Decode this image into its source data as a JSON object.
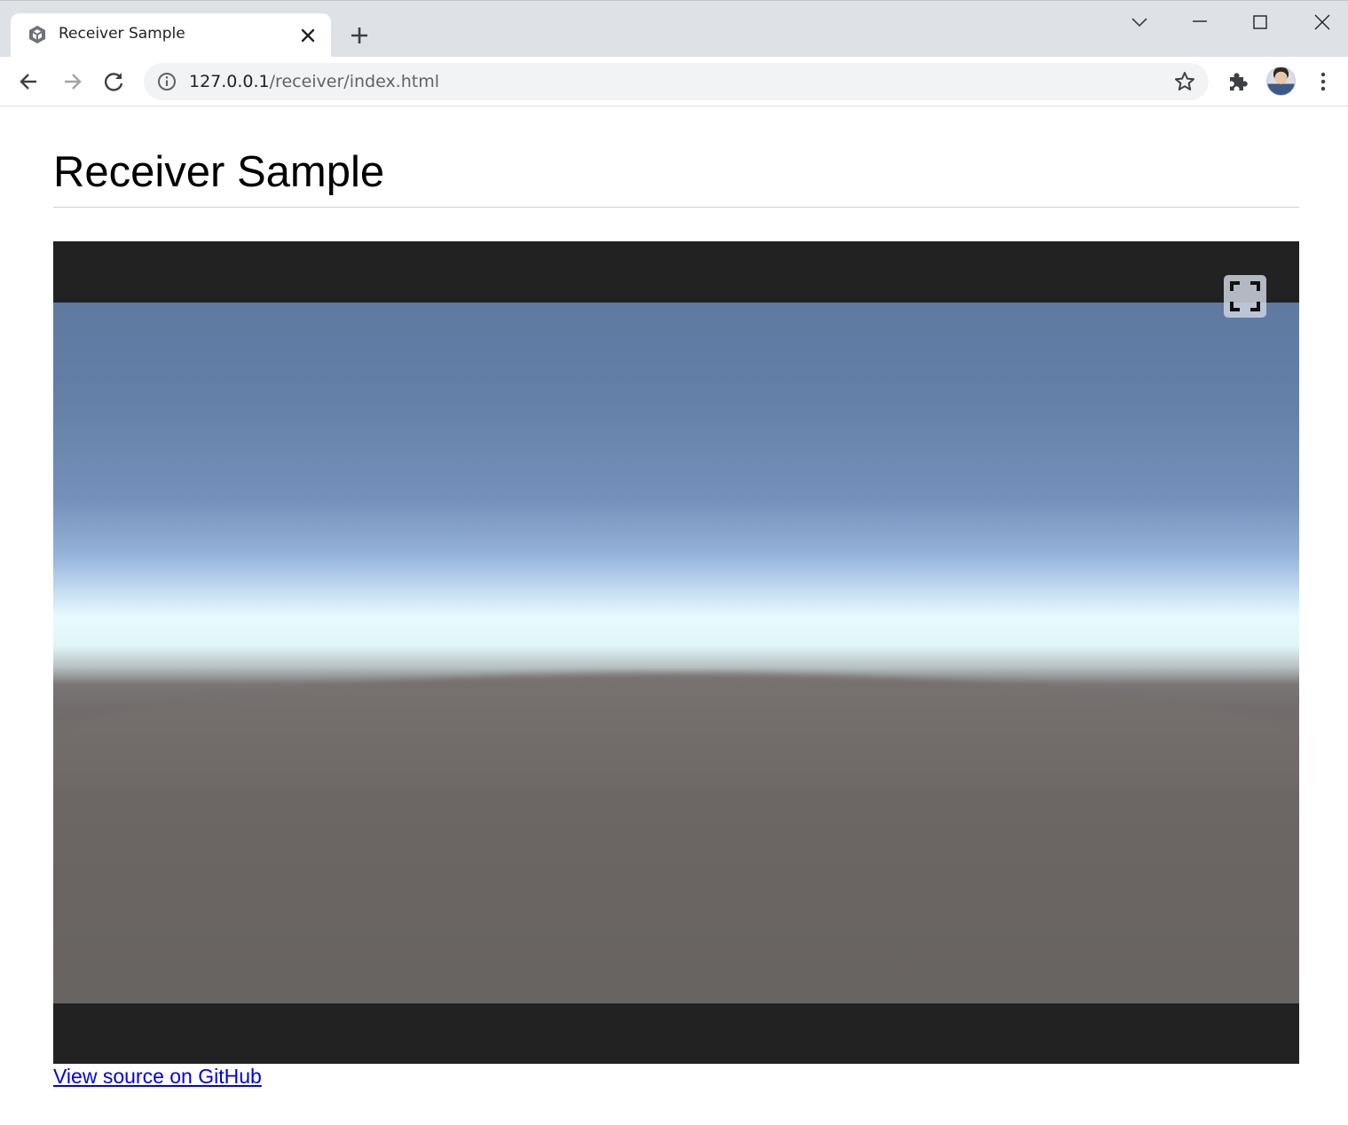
{
  "browser": {
    "tab": {
      "title": "Receiver Sample",
      "favicon": "unity-logo-icon"
    },
    "address_bar": {
      "host": "127.0.0.1",
      "path": "/receiver/index.html"
    },
    "icons": {
      "back": "arrow-left-icon",
      "forward": "arrow-right-icon",
      "reload": "reload-icon",
      "info": "info-icon",
      "bookmark": "star-icon",
      "extensions": "puzzle-icon",
      "menu": "kebab-menu-icon",
      "tab_search": "chevron-down-icon",
      "minimize": "minimize-icon",
      "maximize": "maximize-icon",
      "close": "close-icon",
      "new_tab": "plus-icon"
    }
  },
  "page": {
    "heading": "Receiver Sample",
    "github_link": "View source on GitHub"
  },
  "player": {
    "fullscreen_icon": "fullscreen-icon"
  },
  "colors": {
    "link": "#0000ee",
    "player_background": "#222222",
    "tabstrip": "#dee1e6"
  }
}
